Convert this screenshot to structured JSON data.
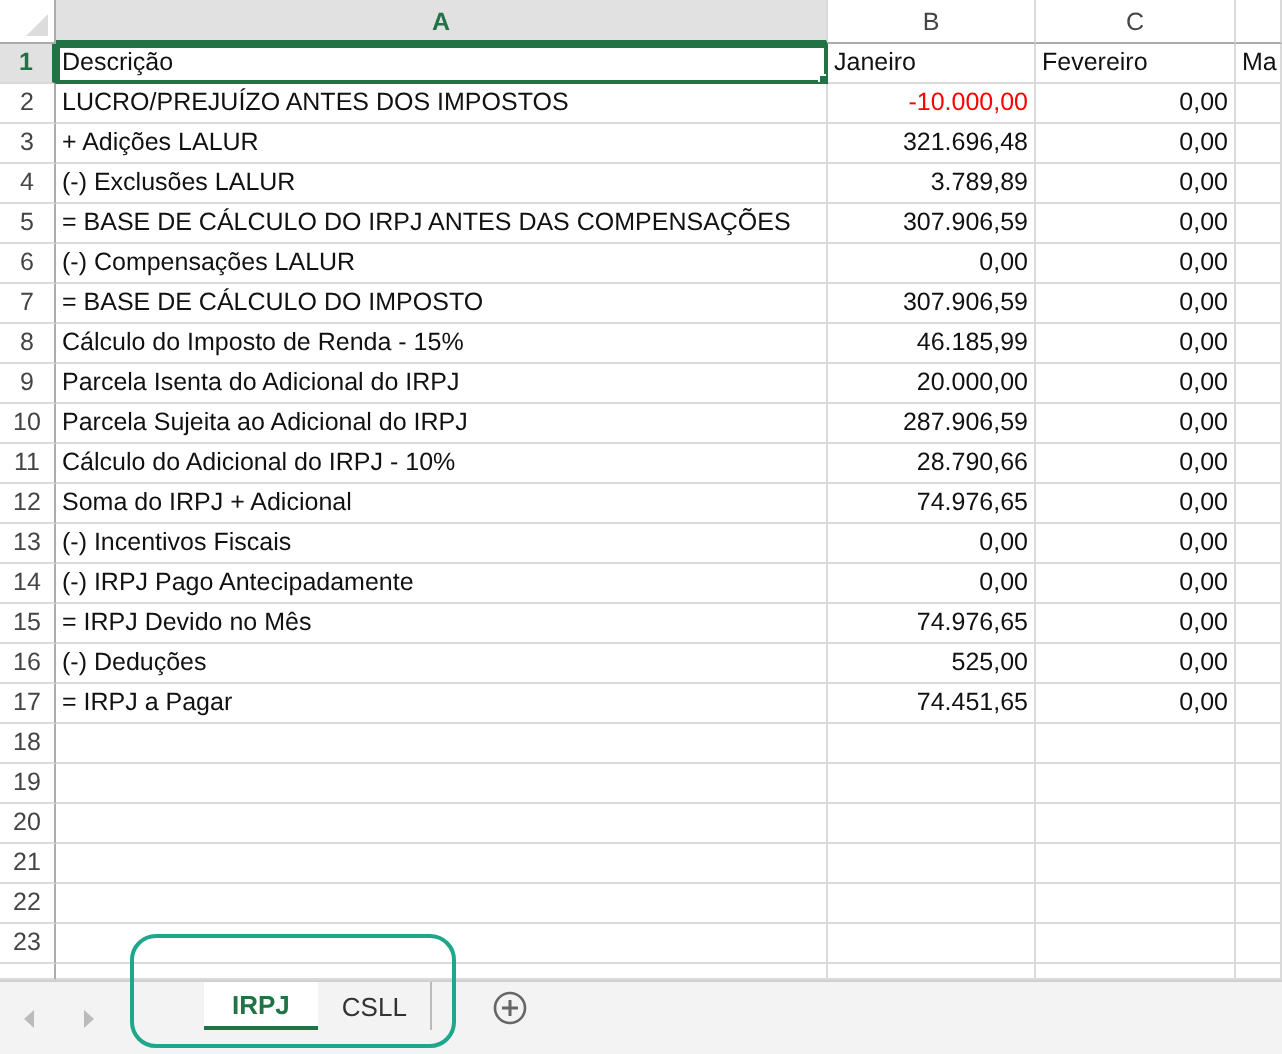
{
  "sheet": {
    "columns": [
      {
        "label": "A",
        "selected": true
      },
      {
        "label": "B",
        "selected": false
      },
      {
        "label": "C",
        "selected": false
      }
    ],
    "rows": [
      {
        "number": "1",
        "selected": true,
        "cells": [
          {
            "text": "Descrição",
            "selected": true,
            "negative": false
          },
          {
            "text": "Janeiro",
            "selected": false,
            "negative": false
          },
          {
            "text": "Fevereiro",
            "selected": false,
            "negative": false
          },
          {
            "text": "Ma",
            "selected": false,
            "negative": false
          }
        ]
      },
      {
        "number": "2",
        "selected": false,
        "cells": [
          {
            "text": "LUCRO/PREJUÍZO ANTES DOS IMPOSTOS",
            "selected": false,
            "negative": false
          },
          {
            "text": "-10.000,00",
            "selected": false,
            "negative": true
          },
          {
            "text": "0,00",
            "selected": false,
            "negative": false
          }
        ]
      },
      {
        "number": "3",
        "selected": false,
        "cells": [
          {
            "text": "+ Adições LALUR",
            "selected": false,
            "negative": false
          },
          {
            "text": "321.696,48",
            "selected": false,
            "negative": false
          },
          {
            "text": "0,00",
            "selected": false,
            "negative": false
          }
        ]
      },
      {
        "number": "4",
        "selected": false,
        "cells": [
          {
            "text": "(-) Exclusões LALUR",
            "selected": false,
            "negative": false
          },
          {
            "text": "3.789,89",
            "selected": false,
            "negative": false
          },
          {
            "text": "0,00",
            "selected": false,
            "negative": false
          }
        ]
      },
      {
        "number": "5",
        "selected": false,
        "cells": [
          {
            "text": "= BASE DE CÁLCULO DO IRPJ ANTES DAS COMPENSAÇÕES",
            "selected": false,
            "negative": false
          },
          {
            "text": "307.906,59",
            "selected": false,
            "negative": false
          },
          {
            "text": "0,00",
            "selected": false,
            "negative": false
          }
        ]
      },
      {
        "number": "6",
        "selected": false,
        "cells": [
          {
            "text": "(-) Compensações LALUR",
            "selected": false,
            "negative": false
          },
          {
            "text": "0,00",
            "selected": false,
            "negative": false
          },
          {
            "text": "0,00",
            "selected": false,
            "negative": false
          }
        ]
      },
      {
        "number": "7",
        "selected": false,
        "cells": [
          {
            "text": "= BASE DE CÁLCULO DO IMPOSTO",
            "selected": false,
            "negative": false
          },
          {
            "text": "307.906,59",
            "selected": false,
            "negative": false
          },
          {
            "text": "0,00",
            "selected": false,
            "negative": false
          }
        ]
      },
      {
        "number": "8",
        "selected": false,
        "cells": [
          {
            "text": "Cálculo do Imposto de Renda - 15%",
            "selected": false,
            "negative": false
          },
          {
            "text": "46.185,99",
            "selected": false,
            "negative": false
          },
          {
            "text": "0,00",
            "selected": false,
            "negative": false
          }
        ]
      },
      {
        "number": "9",
        "selected": false,
        "cells": [
          {
            "text": "Parcela Isenta do Adicional do IRPJ",
            "selected": false,
            "negative": false
          },
          {
            "text": "20.000,00",
            "selected": false,
            "negative": false
          },
          {
            "text": "0,00",
            "selected": false,
            "negative": false
          }
        ]
      },
      {
        "number": "10",
        "selected": false,
        "cells": [
          {
            "text": "Parcela Sujeita ao Adicional do IRPJ",
            "selected": false,
            "negative": false
          },
          {
            "text": "287.906,59",
            "selected": false,
            "negative": false
          },
          {
            "text": "0,00",
            "selected": false,
            "negative": false
          }
        ]
      },
      {
        "number": "11",
        "selected": false,
        "cells": [
          {
            "text": "Cálculo do Adicional do IRPJ - 10%",
            "selected": false,
            "negative": false
          },
          {
            "text": "28.790,66",
            "selected": false,
            "negative": false
          },
          {
            "text": "0,00",
            "selected": false,
            "negative": false
          }
        ]
      },
      {
        "number": "12",
        "selected": false,
        "cells": [
          {
            "text": "Soma do IRPJ + Adicional",
            "selected": false,
            "negative": false
          },
          {
            "text": "74.976,65",
            "selected": false,
            "negative": false
          },
          {
            "text": "0,00",
            "selected": false,
            "negative": false
          }
        ]
      },
      {
        "number": "13",
        "selected": false,
        "cells": [
          {
            "text": "(-) Incentivos Fiscais",
            "selected": false,
            "negative": false
          },
          {
            "text": "0,00",
            "selected": false,
            "negative": false
          },
          {
            "text": "0,00",
            "selected": false,
            "negative": false
          }
        ]
      },
      {
        "number": "14",
        "selected": false,
        "cells": [
          {
            "text": "(-) IRPJ Pago Antecipadamente",
            "selected": false,
            "negative": false
          },
          {
            "text": "0,00",
            "selected": false,
            "negative": false
          },
          {
            "text": "0,00",
            "selected": false,
            "negative": false
          }
        ]
      },
      {
        "number": "15",
        "selected": false,
        "cells": [
          {
            "text": "= IRPJ Devido no Mês",
            "selected": false,
            "negative": false
          },
          {
            "text": "74.976,65",
            "selected": false,
            "negative": false
          },
          {
            "text": "0,00",
            "selected": false,
            "negative": false
          }
        ]
      },
      {
        "number": "16",
        "selected": false,
        "cells": [
          {
            "text": "(-) Deduções",
            "selected": false,
            "negative": false
          },
          {
            "text": "525,00",
            "selected": false,
            "negative": false
          },
          {
            "text": "0,00",
            "selected": false,
            "negative": false
          }
        ]
      },
      {
        "number": "17",
        "selected": false,
        "cells": [
          {
            "text": "= IRPJ a Pagar",
            "selected": false,
            "negative": false
          },
          {
            "text": "74.451,65",
            "selected": false,
            "negative": false
          },
          {
            "text": "0,00",
            "selected": false,
            "negative": false
          }
        ]
      },
      {
        "number": "18",
        "selected": false,
        "cells": []
      },
      {
        "number": "19",
        "selected": false,
        "cells": []
      },
      {
        "number": "20",
        "selected": false,
        "cells": []
      },
      {
        "number": "21",
        "selected": false,
        "cells": []
      },
      {
        "number": "22",
        "selected": false,
        "cells": []
      },
      {
        "number": "23",
        "selected": false,
        "cells": []
      }
    ]
  },
  "sheet_tabs": [
    {
      "label": "IRPJ",
      "selected": true
    },
    {
      "label": "CSLL",
      "selected": false
    }
  ]
}
